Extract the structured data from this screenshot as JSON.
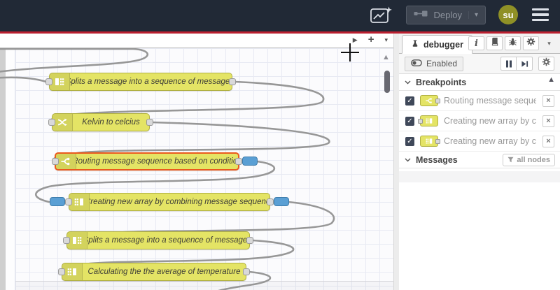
{
  "header": {
    "deploy": {
      "label": "Deploy"
    },
    "avatar": {
      "label": "su"
    }
  },
  "canvas": {
    "nodes": [
      {
        "id": "split1",
        "type": "split",
        "label": "Splits a message into a sequence of messages."
      },
      {
        "id": "kelvin",
        "type": "change",
        "label": "Kelvin to celcius"
      },
      {
        "id": "switch",
        "type": "switch",
        "label": "Routing message sequence based on condition",
        "selected": true,
        "breakpoints": [
          "output"
        ]
      },
      {
        "id": "join1",
        "type": "join",
        "label": "Creating new array by combining message sequence",
        "breakpoints": [
          "input",
          "output"
        ]
      },
      {
        "id": "split2",
        "type": "split",
        "label": "Splits a message into a sequence of messages."
      },
      {
        "id": "avg",
        "type": "join",
        "label": "Calculating the the average of temperature"
      }
    ]
  },
  "sidebar": {
    "tab": {
      "label": "debugger"
    },
    "toolbar": {
      "enabled_label": "Enabled"
    },
    "sections": {
      "breakpoints": {
        "title": "Breakpoints",
        "items": [
          {
            "checked": true,
            "node_type": "switch",
            "port": "output",
            "label": "Routing message sequence ba"
          },
          {
            "checked": true,
            "node_type": "join",
            "port": "input",
            "label": "Creating new array by combini"
          },
          {
            "checked": true,
            "node_type": "join",
            "port": "output",
            "label": "Creating new array by combini"
          }
        ]
      },
      "messages": {
        "title": "Messages",
        "filter_label": "all nodes"
      }
    }
  },
  "icons": {
    "play": "▶",
    "plus": "+",
    "caret_down": "▾",
    "scroll_up": "▲",
    "close": "×",
    "check": "✓"
  },
  "colors": {
    "header_bg": "#212936",
    "header_red": "#bb2030",
    "avatar_bg": "#8f9026",
    "node_fill": "#e4e465",
    "node_border": "#b0b042",
    "node_selected_border": "#ea5a1d",
    "port_fill": "#d9d9d9",
    "breakpoint_blue": "#5a9fd4",
    "wire": "#979797",
    "canvas_grid": "#e8eaf3"
  }
}
